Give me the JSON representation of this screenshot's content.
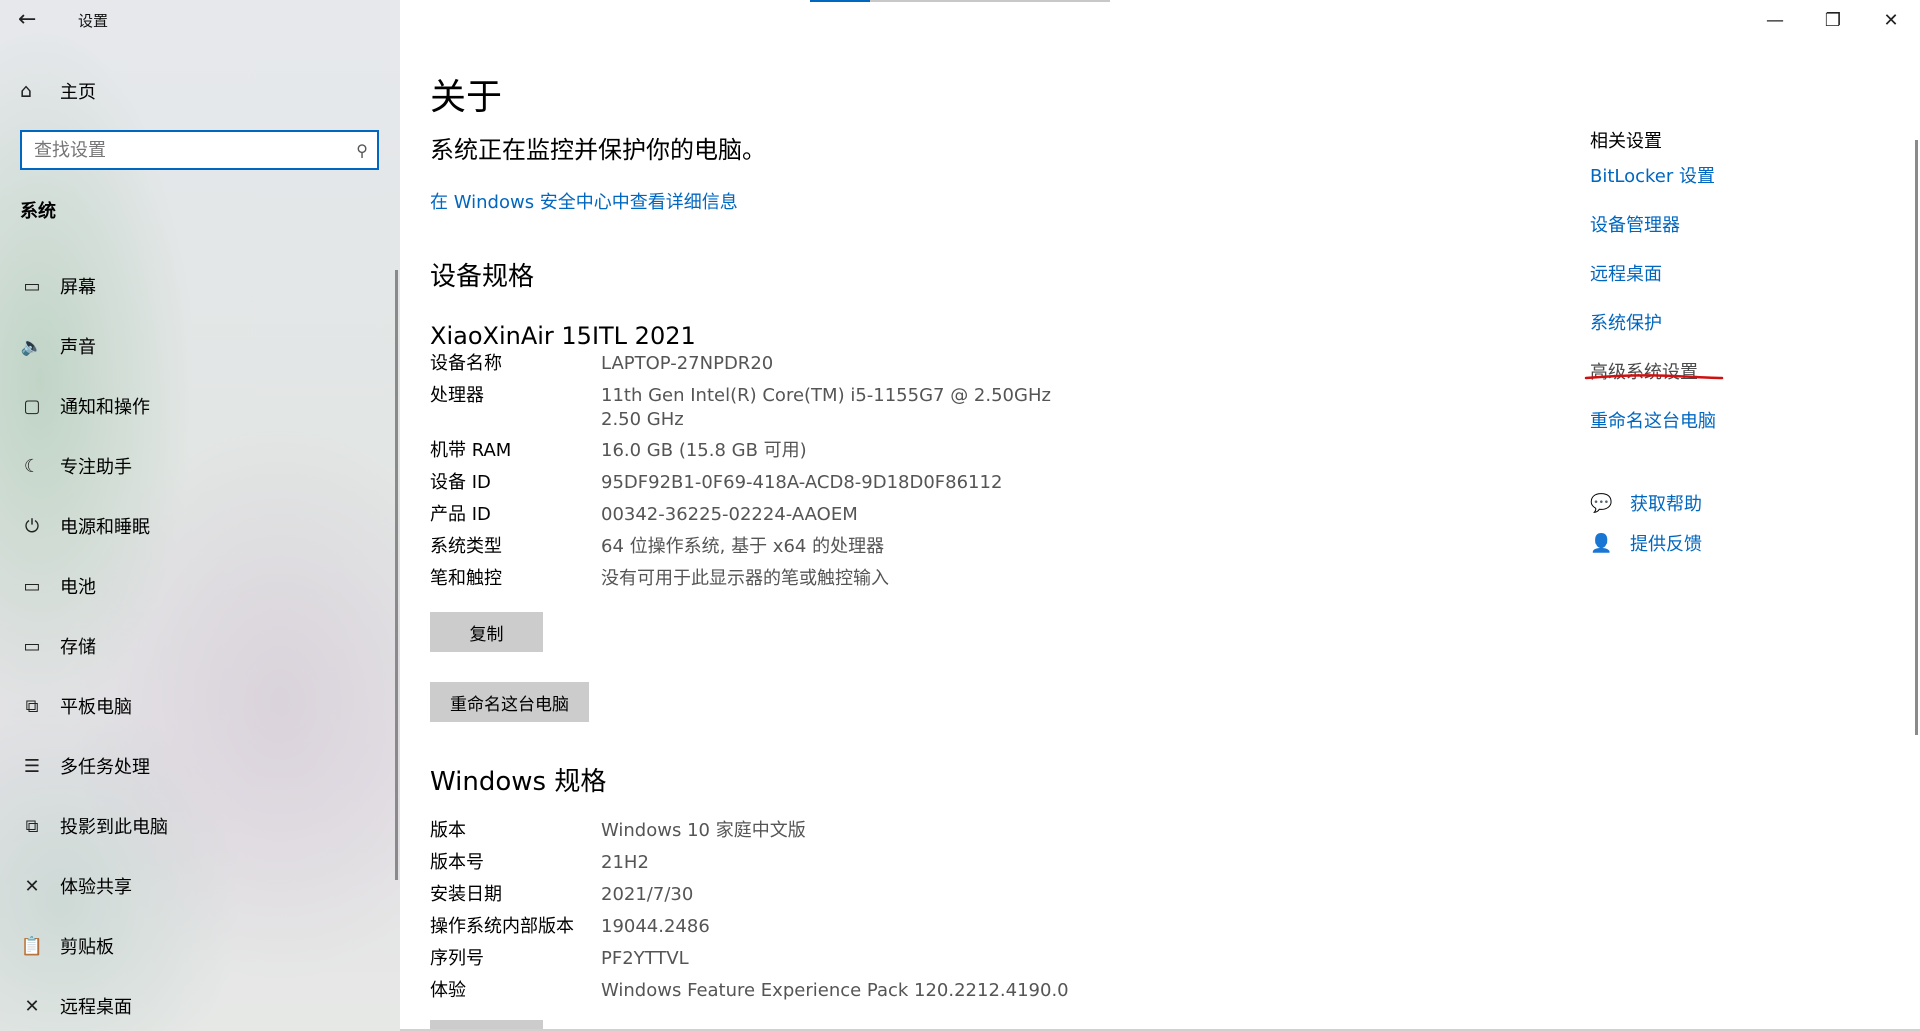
{
  "window": {
    "title": "设置",
    "back_icon": "←",
    "controls": {
      "minimize": "—",
      "restore": "❐",
      "close": "✕"
    }
  },
  "sidebar": {
    "home_label": "主页",
    "search_placeholder": "查找设置",
    "section_title": "系统",
    "items": [
      {
        "icon": "display-icon",
        "glyph": "▭",
        "label": "屏幕"
      },
      {
        "icon": "sound-icon",
        "glyph": "🔈",
        "label": "声音"
      },
      {
        "icon": "notification-icon",
        "glyph": "▢",
        "label": "通知和操作"
      },
      {
        "icon": "focus-assist-icon",
        "glyph": "☾",
        "label": "专注助手"
      },
      {
        "icon": "power-icon",
        "glyph": "⏻",
        "label": "电源和睡眠"
      },
      {
        "icon": "battery-icon",
        "glyph": "▭",
        "label": "电池"
      },
      {
        "icon": "storage-icon",
        "glyph": "▭",
        "label": "存储"
      },
      {
        "icon": "tablet-icon",
        "glyph": "⧉",
        "label": "平板电脑"
      },
      {
        "icon": "multitasking-icon",
        "glyph": "☰",
        "label": "多任务处理"
      },
      {
        "icon": "project-icon",
        "glyph": "⧉",
        "label": "投影到此电脑"
      },
      {
        "icon": "shared-experience-icon",
        "glyph": "✕",
        "label": "体验共享"
      },
      {
        "icon": "clipboard-icon",
        "glyph": "📋",
        "label": "剪贴板"
      },
      {
        "icon": "remote-desktop-icon",
        "glyph": "✕",
        "label": "远程桌面"
      }
    ]
  },
  "main": {
    "title": "关于",
    "status_text": "系统正在监控并保护你的电脑。",
    "security_link": "在 Windows 安全中心中查看详细信息",
    "device_spec_title": "设备规格",
    "device_model": "XiaoXinAir 15ITL 2021",
    "device_specs": [
      {
        "key": "设备名称",
        "value": "LAPTOP-27NPDR20"
      },
      {
        "key": "处理器",
        "value": "11th Gen Intel(R) Core(TM) i5-1155G7 @ 2.50GHz",
        "value2": "2.50 GHz"
      },
      {
        "key": "机带 RAM",
        "value": "16.0 GB (15.8 GB 可用)"
      },
      {
        "key": "设备 ID",
        "value": "95DF92B1-0F69-418A-ACD8-9D18D0F86112"
      },
      {
        "key": "产品 ID",
        "value": "00342-36225-02224-AAOEM"
      },
      {
        "key": "系统类型",
        "value": "64 位操作系统, 基于 x64 的处理器"
      },
      {
        "key": "笔和触控",
        "value": "没有可用于此显示器的笔或触控输入"
      }
    ],
    "copy_button": "复制",
    "rename_button": "重命名这台电脑",
    "windows_spec_title": "Windows 规格",
    "windows_specs": [
      {
        "key": "版本",
        "value": "Windows 10 家庭中文版"
      },
      {
        "key": "版本号",
        "value": "21H2"
      },
      {
        "key": "安装日期",
        "value": "2021/7/30"
      },
      {
        "key": "操作系统内部版本",
        "value": "19044.2486"
      },
      {
        "key": "序列号",
        "value": "PF2YTTVL"
      },
      {
        "key": "体验",
        "value": "Windows Feature Experience Pack 120.2212.4190.0"
      }
    ]
  },
  "related": {
    "title": "相关设置",
    "links": [
      "BitLocker 设置",
      "设备管理器",
      "远程桌面",
      "系统保护",
      "高级系统设置",
      "重命名这台电脑"
    ],
    "get_help": "获取帮助",
    "feedback": "提供反馈"
  },
  "colors": {
    "accent": "#0067c0",
    "annotation": "#d01010"
  }
}
